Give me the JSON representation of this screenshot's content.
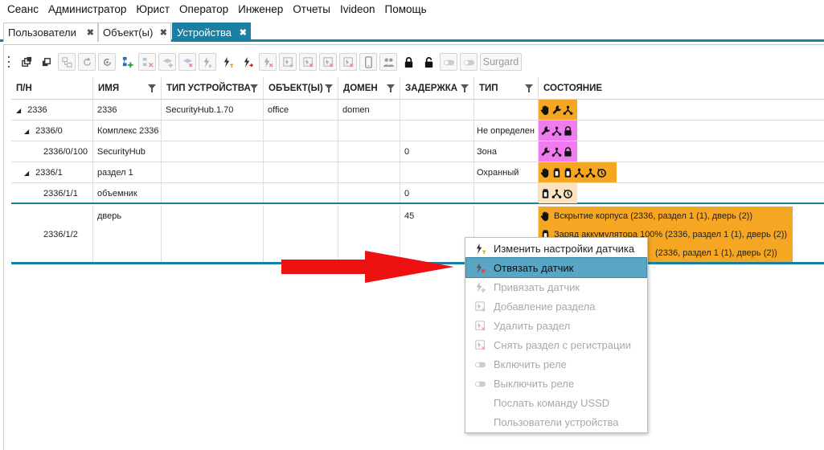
{
  "menu": [
    "Сеанс",
    "Администратор",
    "Юрист",
    "Оператор",
    "Инженер",
    "Отчеты",
    "Ivideon",
    "Помощь"
  ],
  "tabs": [
    {
      "label": "Пользователи",
      "close": "✖"
    },
    {
      "label": "Объект(ы)",
      "close": "✖"
    },
    {
      "label": "Устройства",
      "close": "✖",
      "active": true
    }
  ],
  "toolbar": {
    "surgard_label": "Surgard"
  },
  "columns": [
    "П/Н",
    "ИМЯ",
    "ТИП УСТРОЙСТВА",
    "ОБЪЕКТ(Ы)",
    "ДОМЕН",
    "ЗАДЕРЖКА",
    "ТИП",
    "СОСТОЯНИЕ"
  ],
  "rows": [
    {
      "pn": "2336",
      "name": "2336",
      "type": "SecurityHub.1.70",
      "object": "office",
      "domain": "domen",
      "delay": "",
      "kind": "",
      "expander": "◢"
    },
    {
      "pn": "2336/0",
      "name": "Комплекс 2336",
      "type": "",
      "object": "",
      "domain": "",
      "delay": "",
      "kind": "Не определен",
      "expander": "◢"
    },
    {
      "pn": "2336/0/100",
      "name": "SecurityHub",
      "type": "",
      "object": "",
      "domain": "",
      "delay": "0",
      "kind": "Зона",
      "expander": ""
    },
    {
      "pn": "2336/1",
      "name": "раздел 1",
      "type": "",
      "object": "",
      "domain": "",
      "delay": "",
      "kind": "Охранный",
      "expander": "◢"
    },
    {
      "pn": "2336/1/1",
      "name": "объемник",
      "type": "",
      "object": "",
      "domain": "",
      "delay": "0",
      "kind": "",
      "expander": ""
    },
    {
      "pn": "2336/1/2",
      "name": "дверь",
      "type": "",
      "object": "",
      "domain": "",
      "delay": "45",
      "kind": "",
      "expander": ""
    }
  ],
  "door_states": [
    "Вскрытие корпуса (2336, раздел 1 (1), дверь (2))",
    "Заряд аккумулятора 100%  (2336, раздел 1 (1), дверь (2))",
    "(2336, раздел 1 (1), дверь (2))"
  ],
  "context_menu": [
    {
      "label": "Изменить настройки датчика",
      "icon": "edit-sensor-icon",
      "disabled": false,
      "highlighted": false
    },
    {
      "label": "Отвязать датчик",
      "icon": "unbind-sensor-icon",
      "disabled": false,
      "highlighted": true
    },
    {
      "label": "Привязать датчик",
      "icon": "bind-sensor-icon",
      "disabled": true,
      "highlighted": false
    },
    {
      "label": "Добавление раздела",
      "icon": "add-section-icon",
      "disabled": true,
      "highlighted": false
    },
    {
      "label": "Удалить раздел",
      "icon": "delete-section-icon",
      "disabled": true,
      "highlighted": false
    },
    {
      "label": "Снять раздел с регистрации",
      "icon": "unregister-section-icon",
      "disabled": true,
      "highlighted": false
    },
    {
      "label": "Включить реле",
      "icon": "toggle-icon",
      "disabled": true,
      "highlighted": false
    },
    {
      "label": "Выключить реле",
      "icon": "toggle-icon",
      "disabled": true,
      "highlighted": false
    },
    {
      "label": "Послать команду USSD",
      "icon": "",
      "disabled": true,
      "highlighted": false
    },
    {
      "label": "Пользователи устройства",
      "icon": "",
      "disabled": true,
      "highlighted": false
    }
  ],
  "colors": {
    "accent": "#1a7fa3",
    "magenta": "#f07af0",
    "orange": "#f5a623",
    "arrow": "#ee1111",
    "highlight": "#59a5c3"
  }
}
